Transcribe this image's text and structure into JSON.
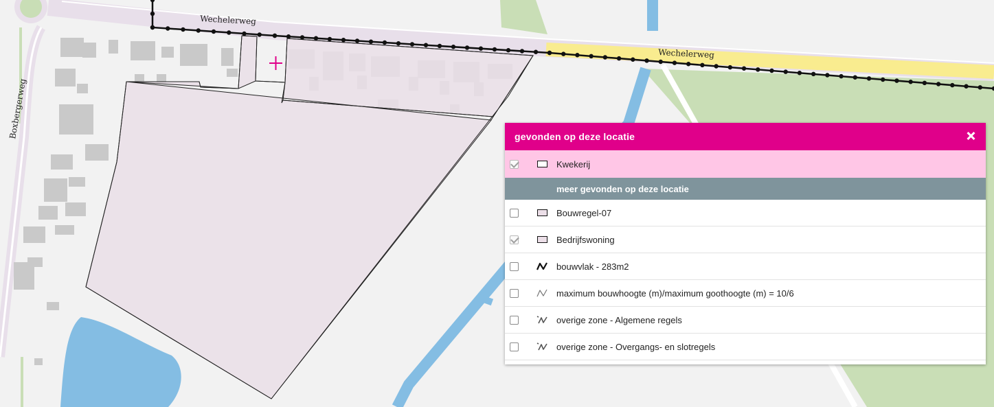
{
  "map": {
    "street_labels": {
      "top_left": "Wechelerweg",
      "top_right": "Wechelerweg",
      "left_vertical": "Boxbergerweg"
    },
    "colors": {
      "background": "#f2f2f2",
      "road": "#e8dfea",
      "main_road": "#f9ec8f",
      "water": "#84bde3",
      "grass": "#c9deb6",
      "buildings": "#c9c9c9",
      "plan_area": "#eadfe8",
      "marker": "#e0008a"
    }
  },
  "panel": {
    "title": "gevonden op deze locatie",
    "close_icon": "close-icon",
    "selected": {
      "label": "Kwekerij",
      "checked": true,
      "symbol": "rect-outline-icon"
    },
    "more_header": "meer gevonden op deze locatie",
    "items": [
      {
        "label": "Bouwregel-07",
        "checked": false,
        "symbol": "rect-filled-icon"
      },
      {
        "label": "Bedrijfswoning",
        "checked": true,
        "symbol": "rect-filled-icon"
      },
      {
        "label": "bouwvlak - 283m2",
        "checked": false,
        "symbol": "zigzag-bold-icon"
      },
      {
        "label": "maximum bouwhoogte (m)/maximum goothoogte (m) = 10/6",
        "checked": false,
        "symbol": "zigzag-light-icon"
      },
      {
        "label": "overige zone - Algemene regels",
        "checked": false,
        "symbol": "zigzag-hook-icon"
      },
      {
        "label": "overige zone - Overgangs- en slotregels",
        "checked": false,
        "symbol": "zigzag-hook-icon"
      }
    ],
    "colors": {
      "header": "#e0008a",
      "selected_row": "#ffc6e6",
      "subheader": "#7f949c"
    }
  }
}
